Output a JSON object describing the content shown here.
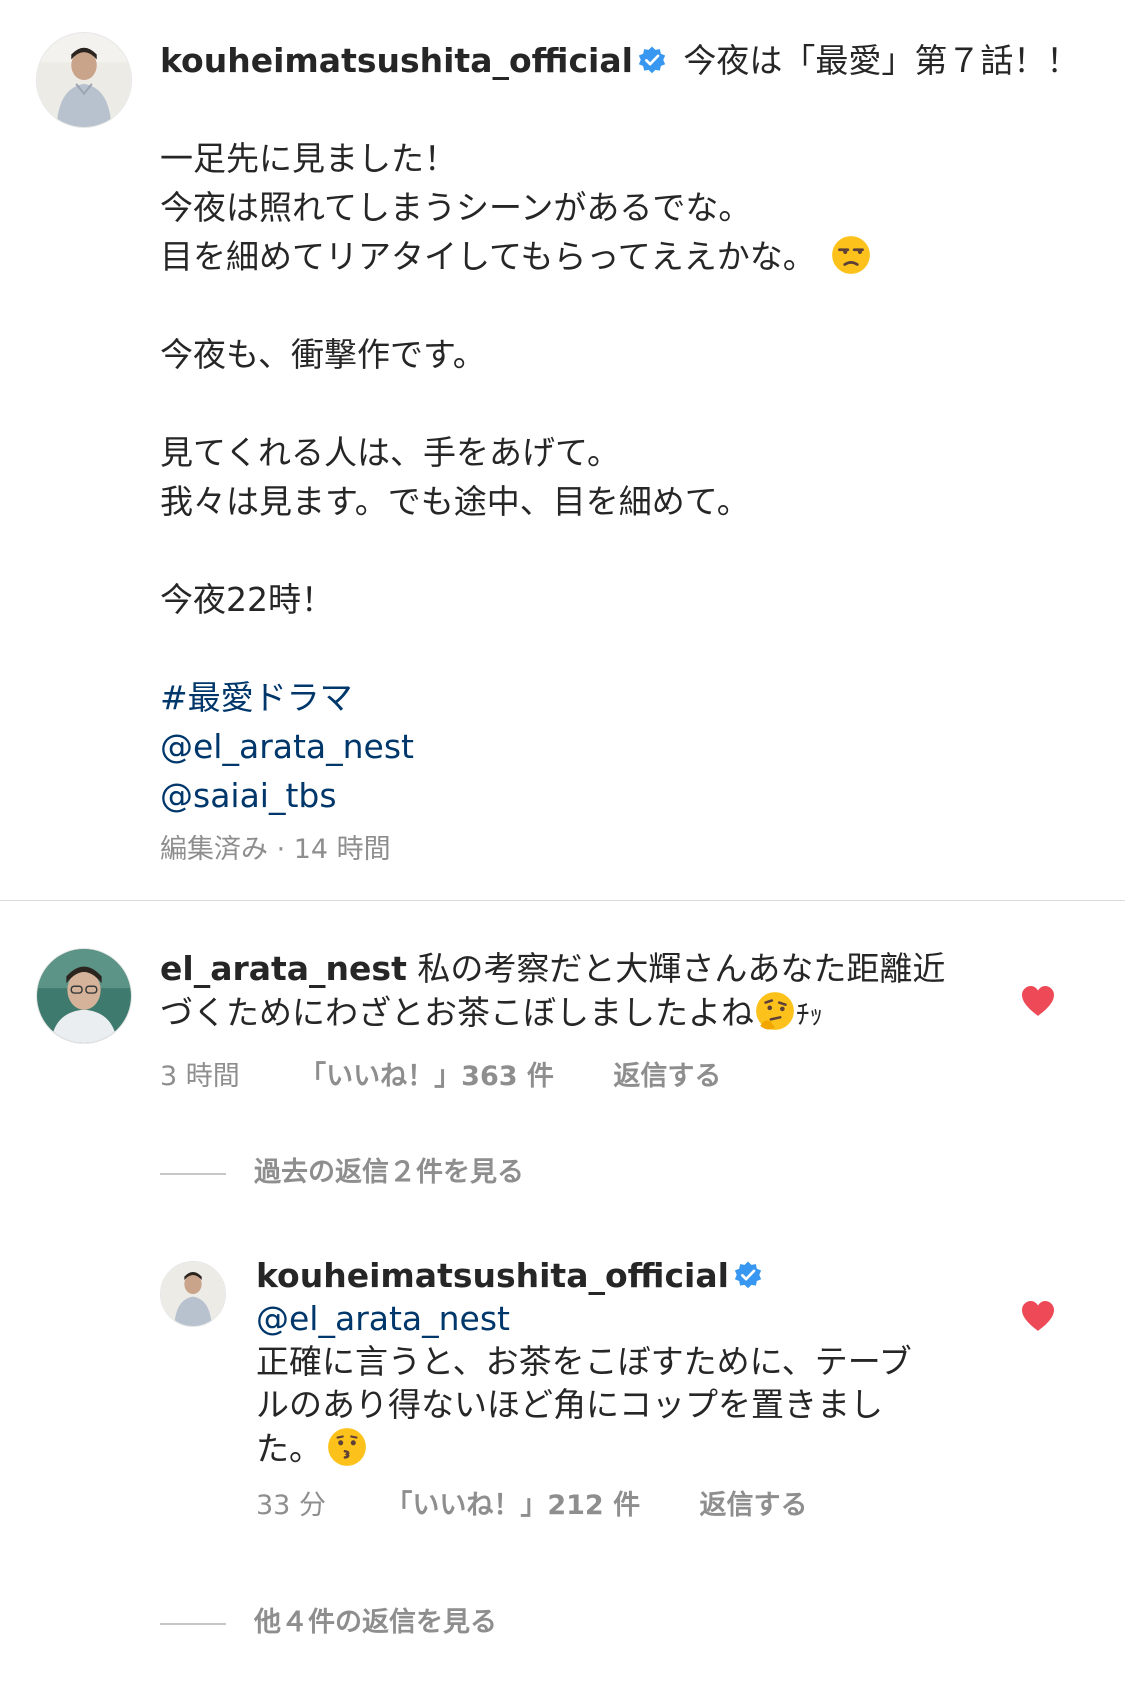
{
  "post": {
    "username": "kouheimatsushita_official",
    "verified_icon": "verified-badge-icon",
    "caption_lines": [
      "今夜は「最愛」第７話！！",
      "一足先に見ました！",
      "今夜は照れてしまうシーンがあるでな。",
      "目を細めてリアタイしてもらってええかな。",
      "今夜も、衝撃作です。",
      "見てくれる人は、手をあげて。",
      "我々は見ます。でも途中、目を細めて。",
      "今夜22時！"
    ],
    "caption_emoji": "unamused-face-emoji",
    "hashtag": "#最愛ドラマ",
    "mentions": [
      "@el_arata_nest",
      "@saiai_tbs"
    ],
    "meta": "編集済み · 14 時間"
  },
  "comment1": {
    "username": "el_arata_nest",
    "text_line1": "私の考察だと大輝さんあなた距離近",
    "text_line2": "づくためにわざとお茶こぼしましたよね",
    "emoji": "thinking-face-emoji",
    "suffix": "ﾁｯ",
    "time": "3 時間",
    "likes": "「いいね！」363 件",
    "reply": "返信する",
    "liked": true
  },
  "view_past_replies": "過去の返信２件を見る",
  "reply1": {
    "username": "kouheimatsushita_official",
    "mention": "@el_arata_nest",
    "text_line1": "正確に言うと、お茶をこぼすために、テーブ",
    "text_line2": "ルのあり得ないほど角にコップを置きまし",
    "text_line3": "た。",
    "emoji": "kissing-face-emoji",
    "time": "33 分",
    "likes": "「いいね！」212 件",
    "reply": "返信する",
    "liked": true
  },
  "view_more_replies": "他４件の返信を見る",
  "colors": {
    "text": "#262626",
    "secondary": "#8e8e8e",
    "link": "#00376b",
    "heart": "#ed4956",
    "verified": "#3897f0"
  }
}
